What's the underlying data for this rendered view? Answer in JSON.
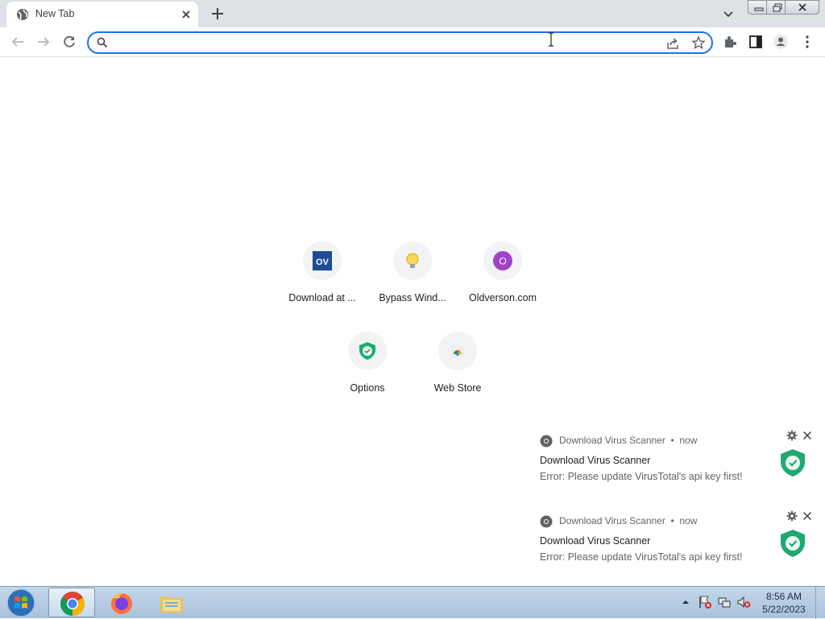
{
  "tab": {
    "title": "New Tab"
  },
  "omnibox": {
    "value": "",
    "placeholder": ""
  },
  "shortcuts": [
    {
      "label": "Download at ...",
      "icon": "ov-logo-icon",
      "badge": "OV"
    },
    {
      "label": "Bypass Wind...",
      "icon": "lightbulb-icon"
    },
    {
      "label": "Oldverson.com",
      "icon": "letter-o-icon",
      "badge": "O"
    },
    {
      "label": "Options",
      "icon": "shield-check-icon"
    },
    {
      "label": "Web Store",
      "icon": "chrome-web-store-icon"
    }
  ],
  "notifications": [
    {
      "app": "Download Virus Scanner",
      "sep": "•",
      "time": "now",
      "title": "Download Virus Scanner",
      "message": "Error: Please update VirusTotal's api key first!"
    },
    {
      "app": "Download Virus Scanner",
      "sep": "•",
      "time": "now",
      "title": "Download Virus Scanner",
      "message": "Error: Please update VirusTotal's api key first!"
    }
  ],
  "taskbar": {
    "time": "8:56 AM",
    "date": "5/22/2023",
    "apps": [
      "chrome",
      "firefox",
      "file-explorer"
    ]
  },
  "colors": {
    "accent": "#1a73e8",
    "tabstrip": "#dee1e6",
    "shield": "#1fa971",
    "ntp_circle": "#f1f3f4"
  }
}
